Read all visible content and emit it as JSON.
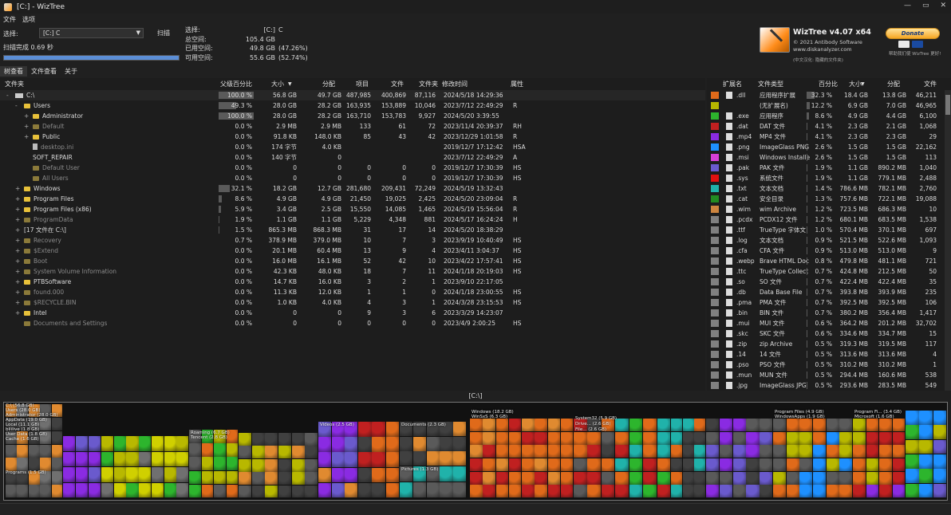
{
  "window": {
    "title": "[C:] - WizTree",
    "controls": [
      "—",
      "▭",
      "✕"
    ]
  },
  "menu": [
    "文件",
    "选项"
  ],
  "toolbar": {
    "select_label": "选择:",
    "drive_value": "[C:] C",
    "scan_label": "扫描",
    "scan_status": "扫描完成 0.69 秒",
    "progress": 1.0
  },
  "drive_info": [
    {
      "k": "选择:",
      "v": "[C:]",
      "p": "C"
    },
    {
      "k": "总空间:",
      "v": "105.4 GB",
      "p": ""
    },
    {
      "k": "已用空间:",
      "v": "49.8 GB",
      "p": "(47.26%)"
    },
    {
      "k": "可用空间:",
      "v": "55.6 GB",
      "p": "(52.74%)"
    }
  ],
  "brand": {
    "version": "WizTree v4.07 x64",
    "copyright": "© 2021 Antibody Software",
    "website": "www.diskanalyzer.com",
    "note": "(中文汉化: 隐藏的文件夹)",
    "donate": "Donate",
    "donate_note": "帮助我们使 WizTree 更好!"
  },
  "tabs": [
    "树查看",
    "文件查看",
    "关于"
  ],
  "tree_headers": [
    "文件夹",
    "父级百分比",
    "大小",
    "分配",
    "项目",
    "文件",
    "文件夹",
    "修改时间",
    "属性"
  ],
  "tree_rows": [
    {
      "ind": 0,
      "exp": "-",
      "icon": "drive",
      "name": "C:\\",
      "pct": "100.0 %",
      "bar": 1.0,
      "size": "56.8 GB",
      "alloc": "49.7 GB",
      "items": "487,985",
      "files": "400,869",
      "folders": "87,116",
      "mod": "2024/5/18 14:29:36",
      "attr": "",
      "dim": false
    },
    {
      "ind": 1,
      "exp": "-",
      "icon": "folder",
      "name": "Users",
      "pct": "49.3 %",
      "bar": 0.493,
      "size": "28.0 GB",
      "alloc": "28.2 GB",
      "items": "163,935",
      "files": "153,889",
      "folders": "10,046",
      "mod": "2023/7/12 22:49:29",
      "attr": "R",
      "dim": false
    },
    {
      "ind": 2,
      "exp": "+",
      "icon": "folder",
      "name": "Administrator",
      "pct": "100.0 %",
      "bar": 1.0,
      "size": "28.0 GB",
      "alloc": "28.2 GB",
      "items": "163,710",
      "files": "153,783",
      "folders": "9,927",
      "mod": "2024/5/20 3:39:55",
      "attr": "",
      "dim": false
    },
    {
      "ind": 2,
      "exp": "+",
      "icon": "folder",
      "name": "Default",
      "pct": "0.0 %",
      "bar": 0,
      "size": "2.9 MB",
      "alloc": "2.9 MB",
      "items": "133",
      "files": "61",
      "folders": "72",
      "mod": "2023/11/4 20:39:37",
      "attr": "RH",
      "dim": true
    },
    {
      "ind": 2,
      "exp": "+",
      "icon": "folder",
      "name": "Public",
      "pct": "0.0 %",
      "bar": 0,
      "size": "91.8 KB",
      "alloc": "148.0 KB",
      "items": "85",
      "files": "43",
      "folders": "42",
      "mod": "2023/12/29 1:01:58",
      "attr": "R",
      "dim": false
    },
    {
      "ind": 2,
      "exp": "",
      "icon": "file",
      "name": "desktop.ini",
      "pct": "0.0 %",
      "bar": 0,
      "size": "174 字节",
      "alloc": "4.0 KB",
      "items": "",
      "files": "",
      "folders": "",
      "mod": "2019/12/7 17:12:42",
      "attr": "HSA",
      "dim": true
    },
    {
      "ind": 2,
      "exp": "",
      "icon": "none",
      "name": "SOFT_REPAIR",
      "pct": "0.0 %",
      "bar": 0,
      "size": "140 字节",
      "alloc": "0",
      "items": "",
      "files": "",
      "folders": "",
      "mod": "2023/7/12 22:49:29",
      "attr": "A",
      "dim": false
    },
    {
      "ind": 2,
      "exp": "",
      "icon": "folder",
      "name": "Default User",
      "pct": "0.0 %",
      "bar": 0,
      "size": "0",
      "alloc": "0",
      "items": "0",
      "files": "0",
      "folders": "0",
      "mod": "2019/12/7 17:30:39",
      "attr": "HS",
      "dim": true
    },
    {
      "ind": 2,
      "exp": "",
      "icon": "folder",
      "name": "All Users",
      "pct": "0.0 %",
      "bar": 0,
      "size": "0",
      "alloc": "0",
      "items": "0",
      "files": "0",
      "folders": "0",
      "mod": "2019/12/7 17:30:39",
      "attr": "HS",
      "dim": true
    },
    {
      "ind": 1,
      "exp": "+",
      "icon": "folder",
      "name": "Windows",
      "pct": "32.1 %",
      "bar": 0.321,
      "size": "18.2 GB",
      "alloc": "12.7 GB",
      "items": "281,680",
      "files": "209,431",
      "folders": "72,249",
      "mod": "2024/5/19 13:32:43",
      "attr": "",
      "dim": false
    },
    {
      "ind": 1,
      "exp": "+",
      "icon": "folder",
      "name": "Program Files",
      "pct": "8.6 %",
      "bar": 0.086,
      "size": "4.9 GB",
      "alloc": "4.9 GB",
      "items": "21,450",
      "files": "19,025",
      "folders": "2,425",
      "mod": "2024/5/20 23:09:04",
      "attr": "R",
      "dim": false
    },
    {
      "ind": 1,
      "exp": "+",
      "icon": "folder",
      "name": "Program Files (x86)",
      "pct": "5.9 %",
      "bar": 0.059,
      "size": "3.4 GB",
      "alloc": "2.5 GB",
      "items": "15,550",
      "files": "14,085",
      "folders": "1,465",
      "mod": "2024/5/19 15:56:04",
      "attr": "R",
      "dim": false
    },
    {
      "ind": 1,
      "exp": "+",
      "icon": "folder",
      "name": "ProgramData",
      "pct": "1.9 %",
      "bar": 0.019,
      "size": "1.1 GB",
      "alloc": "1.1 GB",
      "items": "5,229",
      "files": "4,348",
      "folders": "881",
      "mod": "2024/5/17 16:24:24",
      "attr": "H",
      "dim": true
    },
    {
      "ind": 1,
      "exp": "+",
      "icon": "none",
      "name": "[17 文件在 C:\\]",
      "pct": "1.5 %",
      "bar": 0.015,
      "size": "865.3 MB",
      "alloc": "868.3 MB",
      "items": "31",
      "files": "17",
      "folders": "14",
      "mod": "2024/5/20 18:38:29",
      "attr": "",
      "dim": false
    },
    {
      "ind": 1,
      "exp": "+",
      "icon": "folder",
      "name": "Recovery",
      "pct": "0.7 %",
      "bar": 0,
      "size": "378.9 MB",
      "alloc": "379.0 MB",
      "items": "10",
      "files": "7",
      "folders": "3",
      "mod": "2023/9/19 10:40:49",
      "attr": "HS",
      "dim": true
    },
    {
      "ind": 1,
      "exp": "+",
      "icon": "folder",
      "name": "$Extend",
      "pct": "0.0 %",
      "bar": 0,
      "size": "20.1 MB",
      "alloc": "60.4 MB",
      "items": "13",
      "files": "9",
      "folders": "4",
      "mod": "2023/4/11 3:04:37",
      "attr": "HS",
      "dim": true
    },
    {
      "ind": 1,
      "exp": "+",
      "icon": "folder",
      "name": "Boot",
      "pct": "0.0 %",
      "bar": 0,
      "size": "16.0 MB",
      "alloc": "16.1 MB",
      "items": "52",
      "files": "42",
      "folders": "10",
      "mod": "2023/4/22 17:57:41",
      "attr": "HS",
      "dim": true
    },
    {
      "ind": 1,
      "exp": "+",
      "icon": "folder",
      "name": "System Volume Information",
      "pct": "0.0 %",
      "bar": 0,
      "size": "42.3 KB",
      "alloc": "48.0 KB",
      "items": "18",
      "files": "7",
      "folders": "11",
      "mod": "2024/1/18 20:19:03",
      "attr": "HS",
      "dim": true
    },
    {
      "ind": 1,
      "exp": "+",
      "icon": "folder",
      "name": "PTBSoftware",
      "pct": "0.0 %",
      "bar": 0,
      "size": "14.7 KB",
      "alloc": "16.0 KB",
      "items": "3",
      "files": "2",
      "folders": "1",
      "mod": "2023/9/10 22:17:05",
      "attr": "",
      "dim": false
    },
    {
      "ind": 1,
      "exp": "+",
      "icon": "folder",
      "name": "found.000",
      "pct": "0.0 %",
      "bar": 0,
      "size": "11.3 KB",
      "alloc": "12.0 KB",
      "items": "1",
      "files": "1",
      "folders": "0",
      "mod": "2024/1/18 23:00:55",
      "attr": "HS",
      "dim": true
    },
    {
      "ind": 1,
      "exp": "+",
      "icon": "folder",
      "name": "$RECYCLE.BIN",
      "pct": "0.0 %",
      "bar": 0,
      "size": "1.0 KB",
      "alloc": "4.0 KB",
      "items": "4",
      "files": "3",
      "folders": "1",
      "mod": "2024/3/28 23:15:53",
      "attr": "HS",
      "dim": true
    },
    {
      "ind": 1,
      "exp": "+",
      "icon": "folder",
      "name": "Intel",
      "pct": "0.0 %",
      "bar": 0,
      "size": "0",
      "alloc": "0",
      "items": "9",
      "files": "3",
      "folders": "6",
      "mod": "2023/3/29 14:23:07",
      "attr": "",
      "dim": false
    },
    {
      "ind": 1,
      "exp": "",
      "icon": "folder",
      "name": "Documents and Settings",
      "pct": "0.0 %",
      "bar": 0,
      "size": "0",
      "alloc": "0",
      "items": "0",
      "files": "0",
      "folders": "0",
      "mod": "2023/4/9 2:00:25",
      "attr": "HS",
      "dim": true
    }
  ],
  "ext_headers": [
    "扩展名",
    "文件类型",
    "百分比",
    "大小",
    "分配",
    "文件"
  ],
  "ext_rows": [
    {
      "color": "#e06a1a",
      "ext": ".dll",
      "type": "应用程序扩展",
      "pct": "32.3 %",
      "bar": 0.323,
      "size": "18.4 GB",
      "alloc": "13.8 GB",
      "files": "46,211"
    },
    {
      "color": "#b8b800",
      "ext": "",
      "type": "(无扩展名)",
      "pct": "12.2 %",
      "bar": 0.122,
      "size": "6.9 GB",
      "alloc": "7.0 GB",
      "files": "46,965"
    },
    {
      "color": "#2db52d",
      "ext": ".exe",
      "type": "应用程序",
      "pct": "8.6 %",
      "bar": 0.086,
      "size": "4.9 GB",
      "alloc": "4.4 GB",
      "files": "6,100"
    },
    {
      "color": "#c02020",
      "ext": ".dat",
      "type": "DAT 文件",
      "pct": "4.1 %",
      "bar": 0.041,
      "size": "2.3 GB",
      "alloc": "2.1 GB",
      "files": "1,068"
    },
    {
      "color": "#8a2be2",
      "ext": ".mp4",
      "type": "MP4 文件",
      "pct": "4.1 %",
      "bar": 0.041,
      "size": "2.3 GB",
      "alloc": "2.3 GB",
      "files": "29"
    },
    {
      "color": "#1e90ff",
      "ext": ".png",
      "type": "ImageGlass PNG",
      "pct": "2.6 %",
      "bar": 0.026,
      "size": "1.5 GB",
      "alloc": "1.5 GB",
      "files": "22,162"
    },
    {
      "color": "#d63fd6",
      "ext": ".msi",
      "type": "Windows Installe",
      "pct": "2.6 %",
      "bar": 0.026,
      "size": "1.5 GB",
      "alloc": "1.5 GB",
      "files": "113"
    },
    {
      "color": "#6a5acd",
      "ext": ".pak",
      "type": "PAK 文件",
      "pct": "1.9 %",
      "bar": 0.019,
      "size": "1.1 GB",
      "alloc": "890.2 MB",
      "files": "1,040"
    },
    {
      "color": "#e01010",
      "ext": ".sys",
      "type": "系统文件",
      "pct": "1.9 %",
      "bar": 0.019,
      "size": "1.1 GB",
      "alloc": "779.1 MB",
      "files": "2,488"
    },
    {
      "color": "#20b2aa",
      "ext": ".txt",
      "type": "文本文档",
      "pct": "1.4 %",
      "bar": 0.014,
      "size": "786.6 MB",
      "alloc": "782.1 MB",
      "files": "2,760"
    },
    {
      "color": "#228b22",
      "ext": ".cat",
      "type": "安全目录",
      "pct": "1.3 %",
      "bar": 0.013,
      "size": "757.6 MB",
      "alloc": "722.1 MB",
      "files": "19,088"
    },
    {
      "color": "#cd853f",
      "ext": ".wim",
      "type": "wim Archive",
      "pct": "1.2 %",
      "bar": 0.012,
      "size": "723.5 MB",
      "alloc": "686.3 MB",
      "files": "10"
    },
    {
      "color": "#808080",
      "ext": ".pcdx",
      "type": "PCDX12 文件",
      "pct": "1.2 %",
      "bar": 0.012,
      "size": "680.1 MB",
      "alloc": "683.5 MB",
      "files": "1,538"
    },
    {
      "color": "#808080",
      "ext": ".ttf",
      "type": "TrueType 字体文",
      "pct": "1.0 %",
      "bar": 0.01,
      "size": "570.4 MB",
      "alloc": "370.1 MB",
      "files": "697"
    },
    {
      "color": "#808080",
      "ext": ".log",
      "type": "文本文档",
      "pct": "0.9 %",
      "bar": 0.009,
      "size": "521.5 MB",
      "alloc": "522.6 MB",
      "files": "1,093"
    },
    {
      "color": "#808080",
      "ext": ".cfa",
      "type": "CFA 文件",
      "pct": "0.9 %",
      "bar": 0.009,
      "size": "513.0 MB",
      "alloc": "513.0 MB",
      "files": "9"
    },
    {
      "color": "#808080",
      "ext": ".webp",
      "type": "Brave HTML Doc",
      "pct": "0.8 %",
      "bar": 0.008,
      "size": "479.8 MB",
      "alloc": "481.1 MB",
      "files": "721"
    },
    {
      "color": "#808080",
      "ext": ".ttc",
      "type": "TrueType Collect",
      "pct": "0.7 %",
      "bar": 0.007,
      "size": "424.8 MB",
      "alloc": "212.5 MB",
      "files": "50"
    },
    {
      "color": "#808080",
      "ext": ".so",
      "type": "SO 文件",
      "pct": "0.7 %",
      "bar": 0.007,
      "size": "422.4 MB",
      "alloc": "422.4 MB",
      "files": "35"
    },
    {
      "color": "#808080",
      "ext": ".db",
      "type": "Data Base File",
      "pct": "0.7 %",
      "bar": 0.007,
      "size": "393.8 MB",
      "alloc": "393.9 MB",
      "files": "235"
    },
    {
      "color": "#808080",
      "ext": ".pma",
      "type": "PMA 文件",
      "pct": "0.7 %",
      "bar": 0.007,
      "size": "392.5 MB",
      "alloc": "392.5 MB",
      "files": "106"
    },
    {
      "color": "#808080",
      "ext": ".bin",
      "type": "BIN 文件",
      "pct": "0.7 %",
      "bar": 0.007,
      "size": "380.2 MB",
      "alloc": "356.4 MB",
      "files": "1,417"
    },
    {
      "color": "#808080",
      "ext": ".mui",
      "type": "MUI 文件",
      "pct": "0.6 %",
      "bar": 0.006,
      "size": "364.2 MB",
      "alloc": "201.2 MB",
      "files": "32,702"
    },
    {
      "color": "#808080",
      "ext": ".skc",
      "type": "SKC 文件",
      "pct": "0.6 %",
      "bar": 0.006,
      "size": "334.6 MB",
      "alloc": "334.7 MB",
      "files": "15"
    },
    {
      "color": "#808080",
      "ext": ".zip",
      "type": "zip Archive",
      "pct": "0.5 %",
      "bar": 0.005,
      "size": "319.3 MB",
      "alloc": "319.5 MB",
      "files": "117"
    },
    {
      "color": "#808080",
      "ext": ".14",
      "type": "14 文件",
      "pct": "0.5 %",
      "bar": 0.005,
      "size": "313.6 MB",
      "alloc": "313.6 MB",
      "files": "4"
    },
    {
      "color": "#808080",
      "ext": ".pso",
      "type": "PSO 文件",
      "pct": "0.5 %",
      "bar": 0.005,
      "size": "310.2 MB",
      "alloc": "310.2 MB",
      "files": "1"
    },
    {
      "color": "#808080",
      "ext": ".mun",
      "type": "MUN 文件",
      "pct": "0.5 %",
      "bar": 0.005,
      "size": "294.4 MB",
      "alloc": "160.6 MB",
      "files": "538"
    },
    {
      "color": "#808080",
      "ext": ".jpg",
      "type": "ImageGlass JPG",
      "pct": "0.5 %",
      "bar": 0.005,
      "size": "293.6 MB",
      "alloc": "283.5 MB",
      "files": "549"
    }
  ],
  "treemap": {
    "title": "[C:\\]",
    "labels": [
      "C:\\ (56.8 GB)",
      "Users (28.0 GB)",
      "Administrator (28.0 GB)",
      "AppData (19.0 GB)",
      "Local (11.1 GB)",
      "bililive (1.8 GB)",
      "User Data (1.8 GB)",
      "Cache (1.6 GB)",
      "Programs (1.5 GB)",
      "Roaming (6.7 GB)",
      "Tencent (2.8 GB)",
      "Videos (2.5 GB)",
      "Documents (2.3 GB)",
      "Pictures (1.3 GB)",
      "Windows (18.2 GB)",
      "WinSxS (6.3 GB)",
      "System32 (5.9 GB)",
      "Drive... (2.6 GB)",
      "File... (2.6 GB)",
      "Program Files (4.9 GB)",
      "WindowsApps (1.9 GB)",
      "Program Fi... (3.4 GB)",
      "Microsoft (1.6 GB)"
    ]
  }
}
